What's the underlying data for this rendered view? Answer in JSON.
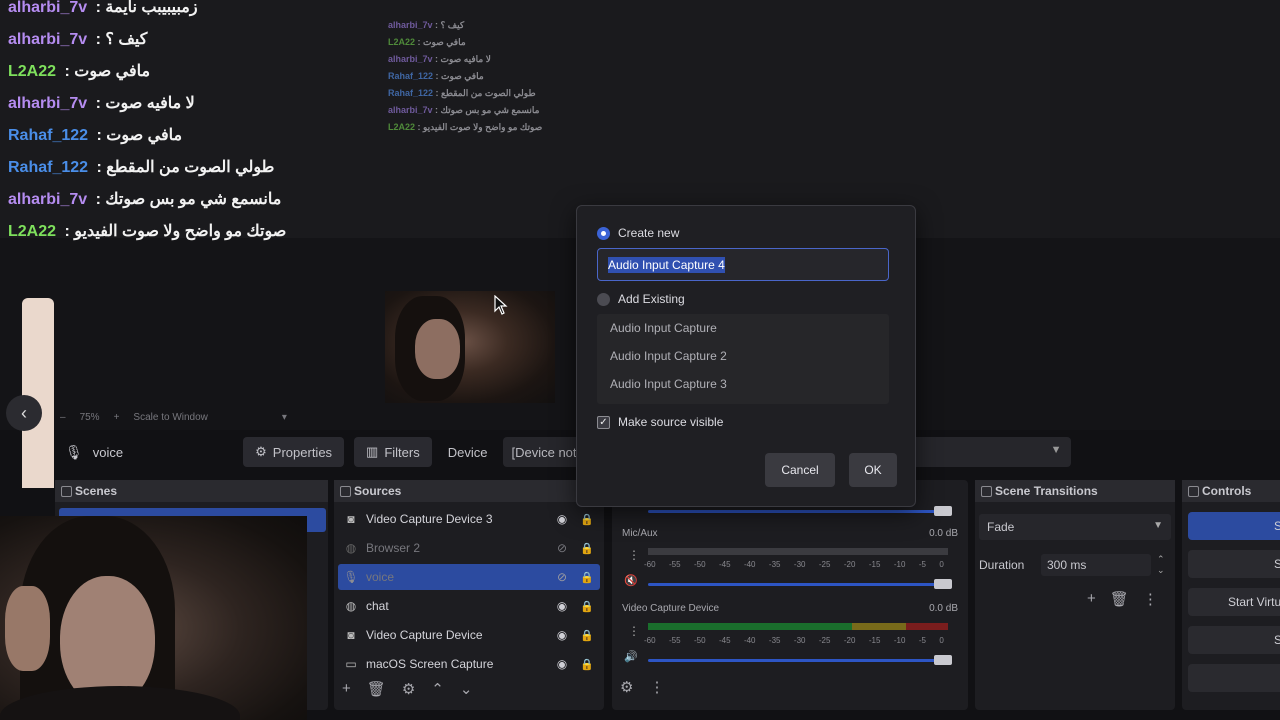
{
  "chat": [
    {
      "user": "alharbi_7v",
      "color": "#b58cf0",
      "message": "زمبيبيبب نايمة",
      "partial": true
    },
    {
      "user": "alharbi_7v",
      "color": "#b58cf0",
      "message": "كيف ؟"
    },
    {
      "user": "L2A22",
      "color": "#7ee05c",
      "message": "مافي صوت"
    },
    {
      "user": "alharbi_7v",
      "color": "#b58cf0",
      "message": "لا مافيه صوت"
    },
    {
      "user": "Rahaf_122",
      "color": "#4a8ee8",
      "message": "مافي صوت"
    },
    {
      "user": "Rahaf_122",
      "color": "#4a8ee8",
      "message": "طولي الصوت من المقطع"
    },
    {
      "user": "alharbi_7v",
      "color": "#b58cf0",
      "message": "مانسمع شي مو بس صوتك"
    },
    {
      "user": "L2A22",
      "color": "#7ee05c",
      "message": "صوتك مو واضح ولا صوت الفيديو"
    }
  ],
  "preview_toolbar": {
    "zoom_minus": "–",
    "zoom": "75%",
    "zoom_plus": "+",
    "scale_mode": "Scale to Window"
  },
  "props_bar": {
    "source_name": "voice",
    "properties": "Properties",
    "filters": "Filters",
    "device_label": "Device",
    "device_value": "[Device not"
  },
  "docks": {
    "scenes_title": "Scenes",
    "sources_title": "Sources",
    "transitions_title": "Scene Transitions",
    "controls_title": "Controls"
  },
  "sources": [
    {
      "name": "Video Capture Device 3",
      "icon": "camera-icon",
      "visible": true,
      "selected": false,
      "dim": false
    },
    {
      "name": "Browser 2",
      "icon": "globe-icon",
      "visible": false,
      "selected": false,
      "dim": true
    },
    {
      "name": "voice",
      "icon": "microphone-icon",
      "visible": false,
      "selected": true,
      "dim": true
    },
    {
      "name": "chat",
      "icon": "globe-icon",
      "visible": true,
      "selected": false,
      "dim": false
    },
    {
      "name": "Video Capture Device",
      "icon": "camera-icon",
      "visible": true,
      "selected": false,
      "dim": false
    },
    {
      "name": "macOS Screen Capture",
      "icon": "monitor-icon",
      "visible": true,
      "selected": false,
      "dim": false
    }
  ],
  "mixer": {
    "channels": [
      {
        "name": "Mic/Aux",
        "db": "0.0 dB"
      },
      {
        "name": "Video Capture Device",
        "db": "0.0 dB"
      }
    ],
    "scale": [
      "-60",
      "-55",
      "-50",
      "-45",
      "-40",
      "-35",
      "-30",
      "-25",
      "-20",
      "-15",
      "-10",
      "-5",
      "0"
    ]
  },
  "transitions": {
    "type": "Fade",
    "duration_label": "Duration",
    "duration": "300 ms"
  },
  "controls": {
    "buttons": [
      "Start Streaming",
      "Start Recording",
      "Start Virtual Camera",
      "Studio Mode"
    ]
  },
  "dialog": {
    "create_new": "Create new",
    "name_value": "Audio Input Capture 4",
    "add_existing": "Add Existing",
    "existing": [
      "Audio Input Capture",
      "Audio Input Capture 2",
      "Audio Input Capture 3"
    ],
    "make_visible": "Make source visible",
    "make_visible_checked": true,
    "cancel": "Cancel",
    "ok": "OK"
  },
  "colors": {
    "accent": "#2c4ba0",
    "dialog_bg": "#1f1f23",
    "dock_bg": "#1d1d21"
  }
}
